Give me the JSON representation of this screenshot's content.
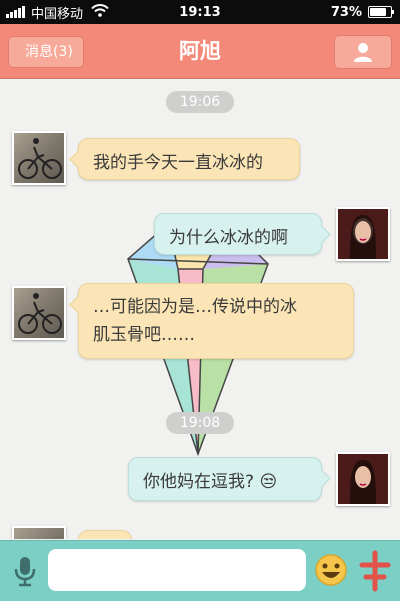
{
  "status_bar": {
    "carrier": "中国移动",
    "time": "19:13",
    "battery": "73%",
    "battery_level": 0.73
  },
  "nav": {
    "back_label": "消息(3)",
    "title": "阿旭",
    "profile_icon": "user-icon"
  },
  "chat": {
    "messages": [
      {
        "type": "time",
        "text": "19:06"
      },
      {
        "type": "in",
        "sender_avatar": "bike-avatar",
        "text": "我的手今天一直冰冰的"
      },
      {
        "type": "out",
        "sender_avatar": "girl-avatar",
        "text": "为什么冰冰的啊"
      },
      {
        "type": "in",
        "sender_avatar": "bike-avatar",
        "line1": "…可能因为是…传说中的冰",
        "line2": "肌玉骨吧……"
      },
      {
        "type": "time",
        "text": "19:08"
      },
      {
        "type": "out",
        "sender_avatar": "girl-avatar",
        "text": "你他妈在逗我?",
        "emoji": "😒"
      }
    ]
  },
  "input_bar": {
    "voice_icon": "microphone-icon",
    "message_value": "",
    "emoji_icon": "emoji-icon",
    "plus_icon": "plus-icon"
  },
  "colors": {
    "nav_bg": "#f4897a",
    "incoming_bubble": "#fbe5b6",
    "outgoing_bubble": "#d7f1ef",
    "input_bar_bg": "#7ccfc5"
  }
}
